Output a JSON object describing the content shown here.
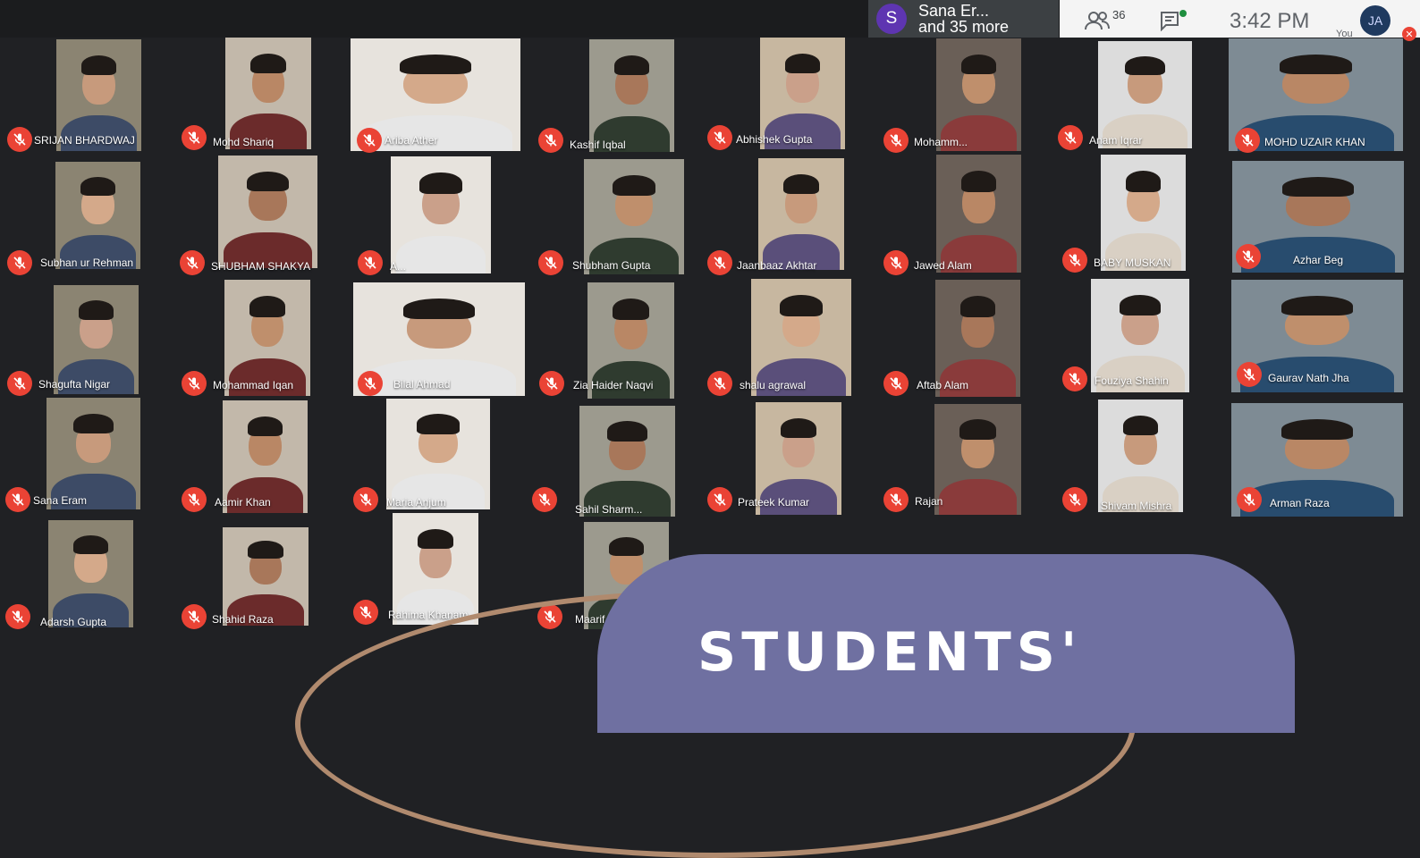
{
  "presenter_chip": {
    "avatar_letter": "S",
    "line1": "Sana Er...",
    "line2": "and 35 more"
  },
  "info_bar": {
    "people_count": "36",
    "time": "3:42 PM",
    "self_avatar": "JA",
    "self_label": "You",
    "icons": [
      "people-icon",
      "chat-icon"
    ]
  },
  "colors": {
    "mic_off": "#ea4335",
    "background": "#202124",
    "overlay": "#6f70a1"
  },
  "overlay": {
    "title": "STUDENTS'"
  },
  "participants": [
    {
      "name": "SRIJAN BHARDWAJ"
    },
    {
      "name": "Mohd Shariq"
    },
    {
      "name": "Ariba Ather"
    },
    {
      "name": "Kashif Iqbal"
    },
    {
      "name": "Abhishek Gupta"
    },
    {
      "name": "Mohamm..."
    },
    {
      "name": "Anam Iqrar"
    },
    {
      "name": "MOHD UZAIR KHAN"
    },
    {
      "name": "Subhan ur Rehman"
    },
    {
      "name": "SHUBHAM SHAKYA"
    },
    {
      "name": "A..."
    },
    {
      "name": "Shubham Gupta"
    },
    {
      "name": "Jaanbaaz Akhtar"
    },
    {
      "name": "Jawed Alam"
    },
    {
      "name": "BABY MUSKAN"
    },
    {
      "name": "Azhar Beg"
    },
    {
      "name": "Shagufta Nigar"
    },
    {
      "name": "Mohammad Iqan"
    },
    {
      "name": "Bilal Ahmad"
    },
    {
      "name": "Zia Haider Naqvi"
    },
    {
      "name": "shalu agrawal"
    },
    {
      "name": "Aftab Alam"
    },
    {
      "name": "Fouziya Shahin"
    },
    {
      "name": "Gaurav Nath Jha"
    },
    {
      "name": "Sana Eram"
    },
    {
      "name": "Aamir Khan"
    },
    {
      "name": "Maria Anjum"
    },
    {
      "name": "Sahil Sharm..."
    },
    {
      "name": "Prateek Kumar"
    },
    {
      "name": "Rajan"
    },
    {
      "name": "Shivam Mishra"
    },
    {
      "name": "Arman Raza"
    },
    {
      "name": "Adarsh Gupta"
    },
    {
      "name": "Shahid Raza"
    },
    {
      "name": "Rahima Khanam"
    },
    {
      "name": "Maarif Ha..."
    }
  ]
}
